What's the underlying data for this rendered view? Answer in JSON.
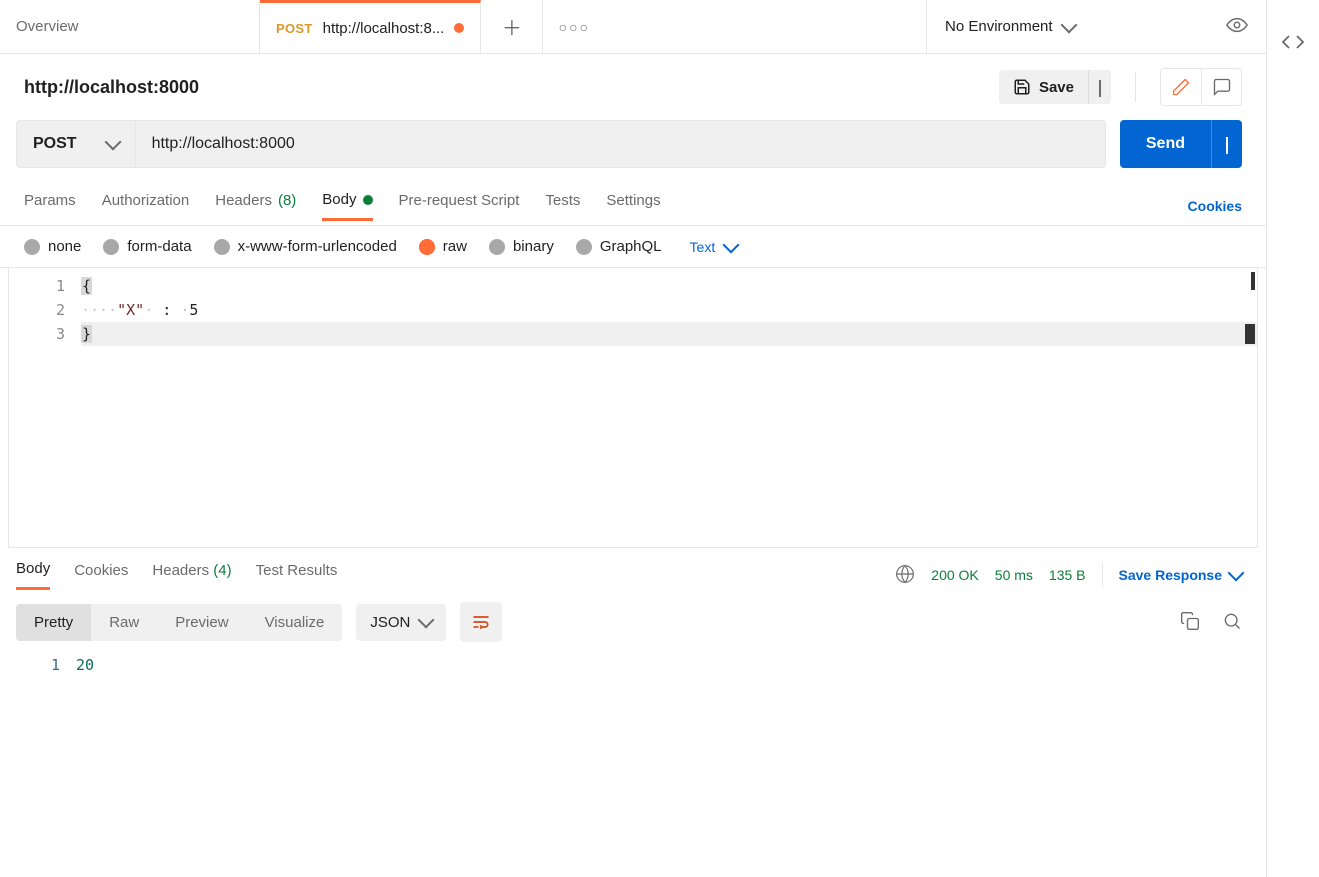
{
  "tabs": {
    "overview": "Overview",
    "active": {
      "method": "POST",
      "title": "http://localhost:8..."
    }
  },
  "env": {
    "label": "No Environment"
  },
  "request": {
    "title": "http://localhost:8000",
    "save": "Save",
    "method": "POST",
    "url": "http://localhost:8000",
    "send": "Send"
  },
  "reqTabs": {
    "params": "Params",
    "auth": "Authorization",
    "headers": "Headers",
    "headersCount": "(8)",
    "body": "Body",
    "prereq": "Pre-request Script",
    "tests": "Tests",
    "settings": "Settings",
    "cookies": "Cookies"
  },
  "bodyTypes": {
    "none": "none",
    "formdata": "form-data",
    "xwww": "x-www-form-urlencoded",
    "raw": "raw",
    "binary": "binary",
    "graphql": "GraphQL",
    "textDrop": "Text"
  },
  "editor": {
    "ln1": "{",
    "ln2_key": "\"X\"",
    "ln2_colon": " : ",
    "ln2_val": "5",
    "ln3": "}",
    "g1": "1",
    "g2": "2",
    "g3": "3"
  },
  "respTabs": {
    "body": "Body",
    "cookies": "Cookies",
    "headers": "Headers",
    "headersCount": "(4)",
    "test": "Test Results"
  },
  "respMeta": {
    "status": "200 OK",
    "time": "50 ms",
    "size": "135 B",
    "save": "Save Response"
  },
  "respView": {
    "pretty": "Pretty",
    "raw": "Raw",
    "preview": "Preview",
    "visualize": "Visualize",
    "json": "JSON"
  },
  "respBody": {
    "g1": "1",
    "val": "20"
  }
}
